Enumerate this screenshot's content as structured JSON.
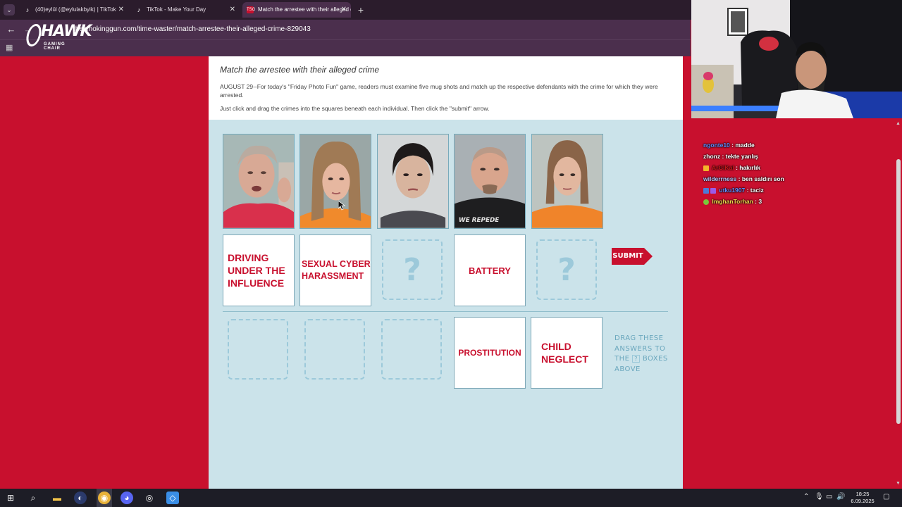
{
  "browser": {
    "tabs": [
      {
        "label": "(40)eylül (@eylulakbyik) | TikTok",
        "active": false
      },
      {
        "label": "TikTok - Make Your Day",
        "active": false
      },
      {
        "label": "Match the arrestee with their alleged crime",
        "active": true
      }
    ],
    "url": "thesmokinggun.com/time-waster/match-arrestee-their-alleged-crime-829043"
  },
  "overlay_logo": {
    "word": "HAWK",
    "sub": "GAMING CHAIR"
  },
  "article": {
    "title": "Match the arrestee with their alleged crime",
    "intro": "AUGUST 29--For today's \"Friday Photo Fun\" game, readers must examine five mug shots and match up the respective defendants with the crime for which they were arrested.",
    "instructions": "Just click and drag the crimes into the squares beneath each individual. Then click the \"submit\" arrow."
  },
  "game": {
    "placed_answers": [
      {
        "slot": 1,
        "label": "DRIVING UNDER THE INFLUENCE"
      },
      {
        "slot": 2,
        "label": "SEXUAL CYBER HARASSMENT"
      },
      {
        "slot": 3,
        "label": "?"
      },
      {
        "slot": 4,
        "label": "BATTERY"
      },
      {
        "slot": 5,
        "label": "?"
      }
    ],
    "remaining_answers": [
      "PROSTITUTION",
      "CHILD NEGLECT"
    ],
    "submit_label": "SUBMIT",
    "drag_hint_1": "DRAG THESE ANSWERS TO THE",
    "drag_hint_q": "?",
    "drag_hint_2": "BOXES ABOVE"
  },
  "chat": [
    {
      "user": "ngonte10",
      "message": "madde",
      "color": "#5b8cff"
    },
    {
      "user": "zhonz",
      "message": "tekte yanlış",
      "color": "#ffffff"
    },
    {
      "user": "ArGIKal",
      "message": "hakırlık",
      "color": "#c81a1a"
    },
    {
      "user": "wilderrness",
      "message": "ben saldırı son",
      "color": "#b0c8ff"
    },
    {
      "user": "utku1907",
      "message": "taciz",
      "color": "#5b8cff"
    },
    {
      "user": "ImghanTorhan",
      "message": "3",
      "color": "#e8d84a"
    }
  ],
  "taskbar": {
    "time": "18:25",
    "date": "6.09.2025"
  },
  "colors": {
    "brand_red": "#c8102e",
    "game_bg": "#cbe3ea",
    "chrome_bg": "#4b2f4d"
  }
}
